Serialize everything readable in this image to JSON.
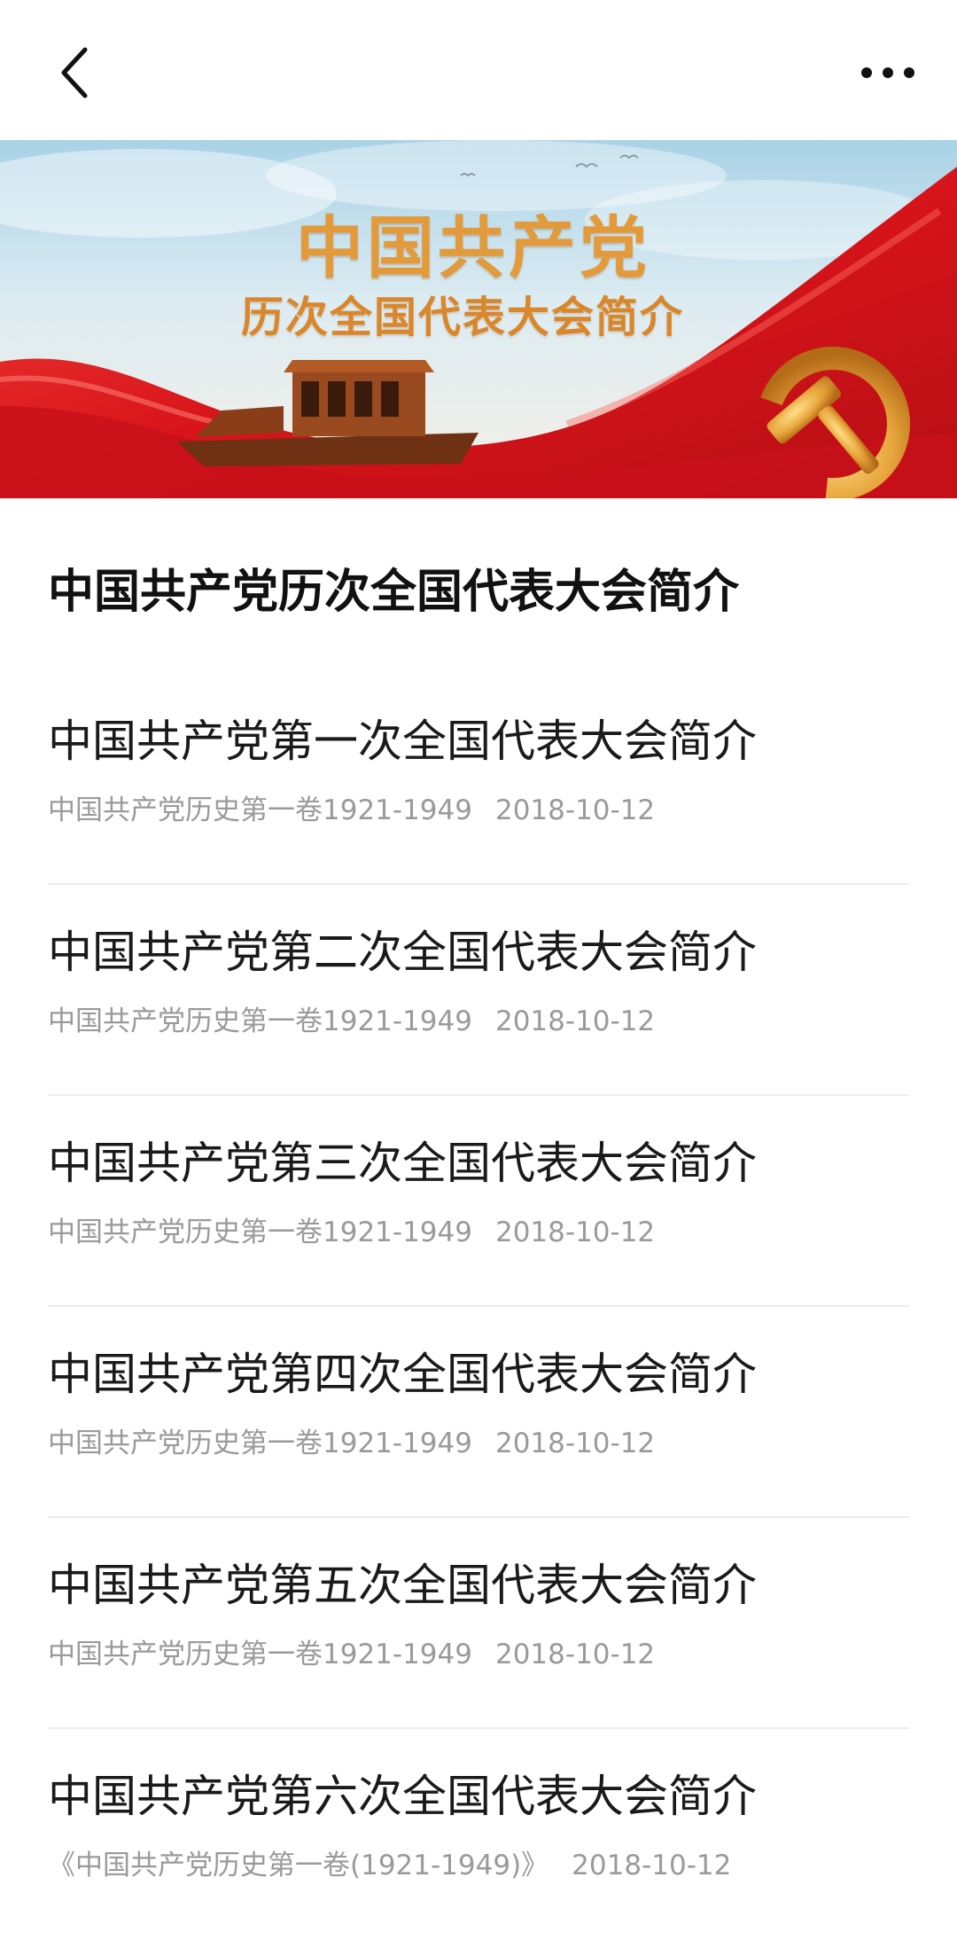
{
  "header": {
    "back_icon": "chevron-left-icon",
    "more_icon": "more-dots-icon"
  },
  "banner": {
    "title": "中国共产党",
    "subtitle": "历次全国代表大会简介"
  },
  "page": {
    "heading": "中国共产党历次全国代表大会简介"
  },
  "articles": [
    {
      "title": "中国共产党第一次全国代表大会简介",
      "source": "中国共产党历史第一卷1921-1949",
      "date": "2018-10-12"
    },
    {
      "title": "中国共产党第二次全国代表大会简介",
      "source": "中国共产党历史第一卷1921-1949",
      "date": "2018-10-12"
    },
    {
      "title": "中国共产党第三次全国代表大会简介",
      "source": "中国共产党历史第一卷1921-1949",
      "date": "2018-10-12"
    },
    {
      "title": "中国共产党第四次全国代表大会简介",
      "source": "中国共产党历史第一卷1921-1949",
      "date": "2018-10-12"
    },
    {
      "title": "中国共产党第五次全国代表大会简介",
      "source": "中国共产党历史第一卷1921-1949",
      "date": "2018-10-12"
    },
    {
      "title": "中国共产党第六次全国代表大会简介",
      "source": "《中国共产党历史第一卷(1921-1949)》",
      "date": "2018-10-12"
    }
  ],
  "colors": {
    "banner_red": "#d91e18",
    "banner_gold": "#e29a3a",
    "meta_gray": "#9a9a9a"
  }
}
